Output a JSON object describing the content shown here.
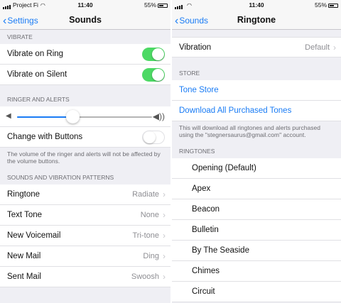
{
  "left": {
    "status": {
      "carrier": "Project Fi",
      "time": "11:40",
      "battery": "55%"
    },
    "nav": {
      "back_label": "Settings",
      "title": "Sounds"
    },
    "vibrate": {
      "header": "VIBRATE",
      "ring_label": "Vibrate on Ring",
      "ring_on": true,
      "silent_label": "Vibrate on Silent",
      "silent_on": true
    },
    "ringer": {
      "header": "RINGER AND ALERTS",
      "volume_level": 0.41,
      "change_label": "Change with Buttons",
      "change_on": false,
      "footnote": "The volume of the ringer and alerts will not be affected by the volume buttons."
    },
    "patterns": {
      "header": "SOUNDS AND VIBRATION PATTERNS",
      "rows": [
        {
          "label": "Ringtone",
          "value": "Radiate"
        },
        {
          "label": "Text Tone",
          "value": "None"
        },
        {
          "label": "New Voicemail",
          "value": "Tri-tone"
        },
        {
          "label": "New Mail",
          "value": "Ding"
        },
        {
          "label": "Sent Mail",
          "value": "Swoosh"
        }
      ]
    }
  },
  "right": {
    "status": {
      "carrier": "",
      "time": "11:40",
      "battery": "55%"
    },
    "nav": {
      "back_label": "Sounds",
      "title": "Ringtone"
    },
    "vibration": {
      "label": "Vibration",
      "value": "Default"
    },
    "store": {
      "header": "STORE",
      "tone_store": "Tone Store",
      "download_all": "Download All Purchased Tones",
      "footnote": "This will download all ringtones and alerts purchased using the \"stegnersaurus@gmail.com\" account."
    },
    "ringtones": {
      "header": "RINGTONES",
      "items": [
        "Opening (Default)",
        "Apex",
        "Beacon",
        "Bulletin",
        "By The Seaside",
        "Chimes",
        "Circuit"
      ]
    }
  },
  "colors": {
    "accent": "#1a7cf5",
    "switch_on": "#4cd964",
    "background": "#efeff4"
  }
}
